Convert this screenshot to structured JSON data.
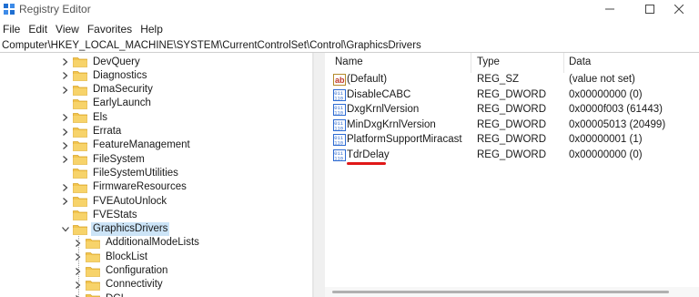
{
  "window": {
    "title": "Registry Editor"
  },
  "menu": [
    "File",
    "Edit",
    "View",
    "Favorites",
    "Help"
  ],
  "address": "Computer\\HKEY_LOCAL_MACHINE\\SYSTEM\\CurrentControlSet\\Control\\GraphicsDrivers",
  "tree": [
    {
      "label": "DevQuery",
      "expandable": true
    },
    {
      "label": "Diagnostics",
      "expandable": true
    },
    {
      "label": "DmaSecurity",
      "expandable": true
    },
    {
      "label": "EarlyLaunch",
      "expandable": false
    },
    {
      "label": "Els",
      "expandable": true
    },
    {
      "label": "Errata",
      "expandable": true
    },
    {
      "label": "FeatureManagement",
      "expandable": true
    },
    {
      "label": "FileSystem",
      "expandable": true
    },
    {
      "label": "FileSystemUtilities",
      "expandable": false
    },
    {
      "label": "FirmwareResources",
      "expandable": true
    },
    {
      "label": "FVEAutoUnlock",
      "expandable": true
    },
    {
      "label": "FVEStats",
      "expandable": false
    },
    {
      "label": "GraphicsDrivers",
      "expandable": true,
      "expanded": true,
      "selected": true
    },
    {
      "label": "AdditionalModeLists",
      "expandable": true,
      "child": true
    },
    {
      "label": "BlockList",
      "expandable": true,
      "child": true
    },
    {
      "label": "Configuration",
      "expandable": true,
      "child": true
    },
    {
      "label": "Connectivity",
      "expandable": true,
      "child": true
    },
    {
      "label": "DCI",
      "expandable": true,
      "child": true
    }
  ],
  "list": {
    "headers": {
      "name": "Name",
      "type": "Type",
      "data": "Data"
    },
    "rows": [
      {
        "name": "(Default)",
        "type": "REG_SZ",
        "data": "(value not set)",
        "icon": "string-value-icon"
      },
      {
        "name": "DisableCABC",
        "type": "REG_DWORD",
        "data": "0x00000000 (0)",
        "icon": "binary-value-icon"
      },
      {
        "name": "DxgKrnlVersion",
        "type": "REG_DWORD",
        "data": "0x0000f003 (61443)",
        "icon": "binary-value-icon"
      },
      {
        "name": "MinDxgKrnlVersion",
        "type": "REG_DWORD",
        "data": "0x00005013 (20499)",
        "icon": "binary-value-icon"
      },
      {
        "name": "PlatformSupportMiracast",
        "type": "REG_DWORD",
        "data": "0x00000001 (1)",
        "icon": "binary-value-icon"
      },
      {
        "name": "TdrDelay",
        "type": "REG_DWORD",
        "data": "0x00000000 (0)",
        "icon": "binary-value-icon",
        "highlighted": true
      }
    ]
  },
  "colors": {
    "accent_underline": "#e01818",
    "folder": "#f2c44e",
    "selection": "#cce4f7",
    "value_icon": "#2e6bd1"
  }
}
